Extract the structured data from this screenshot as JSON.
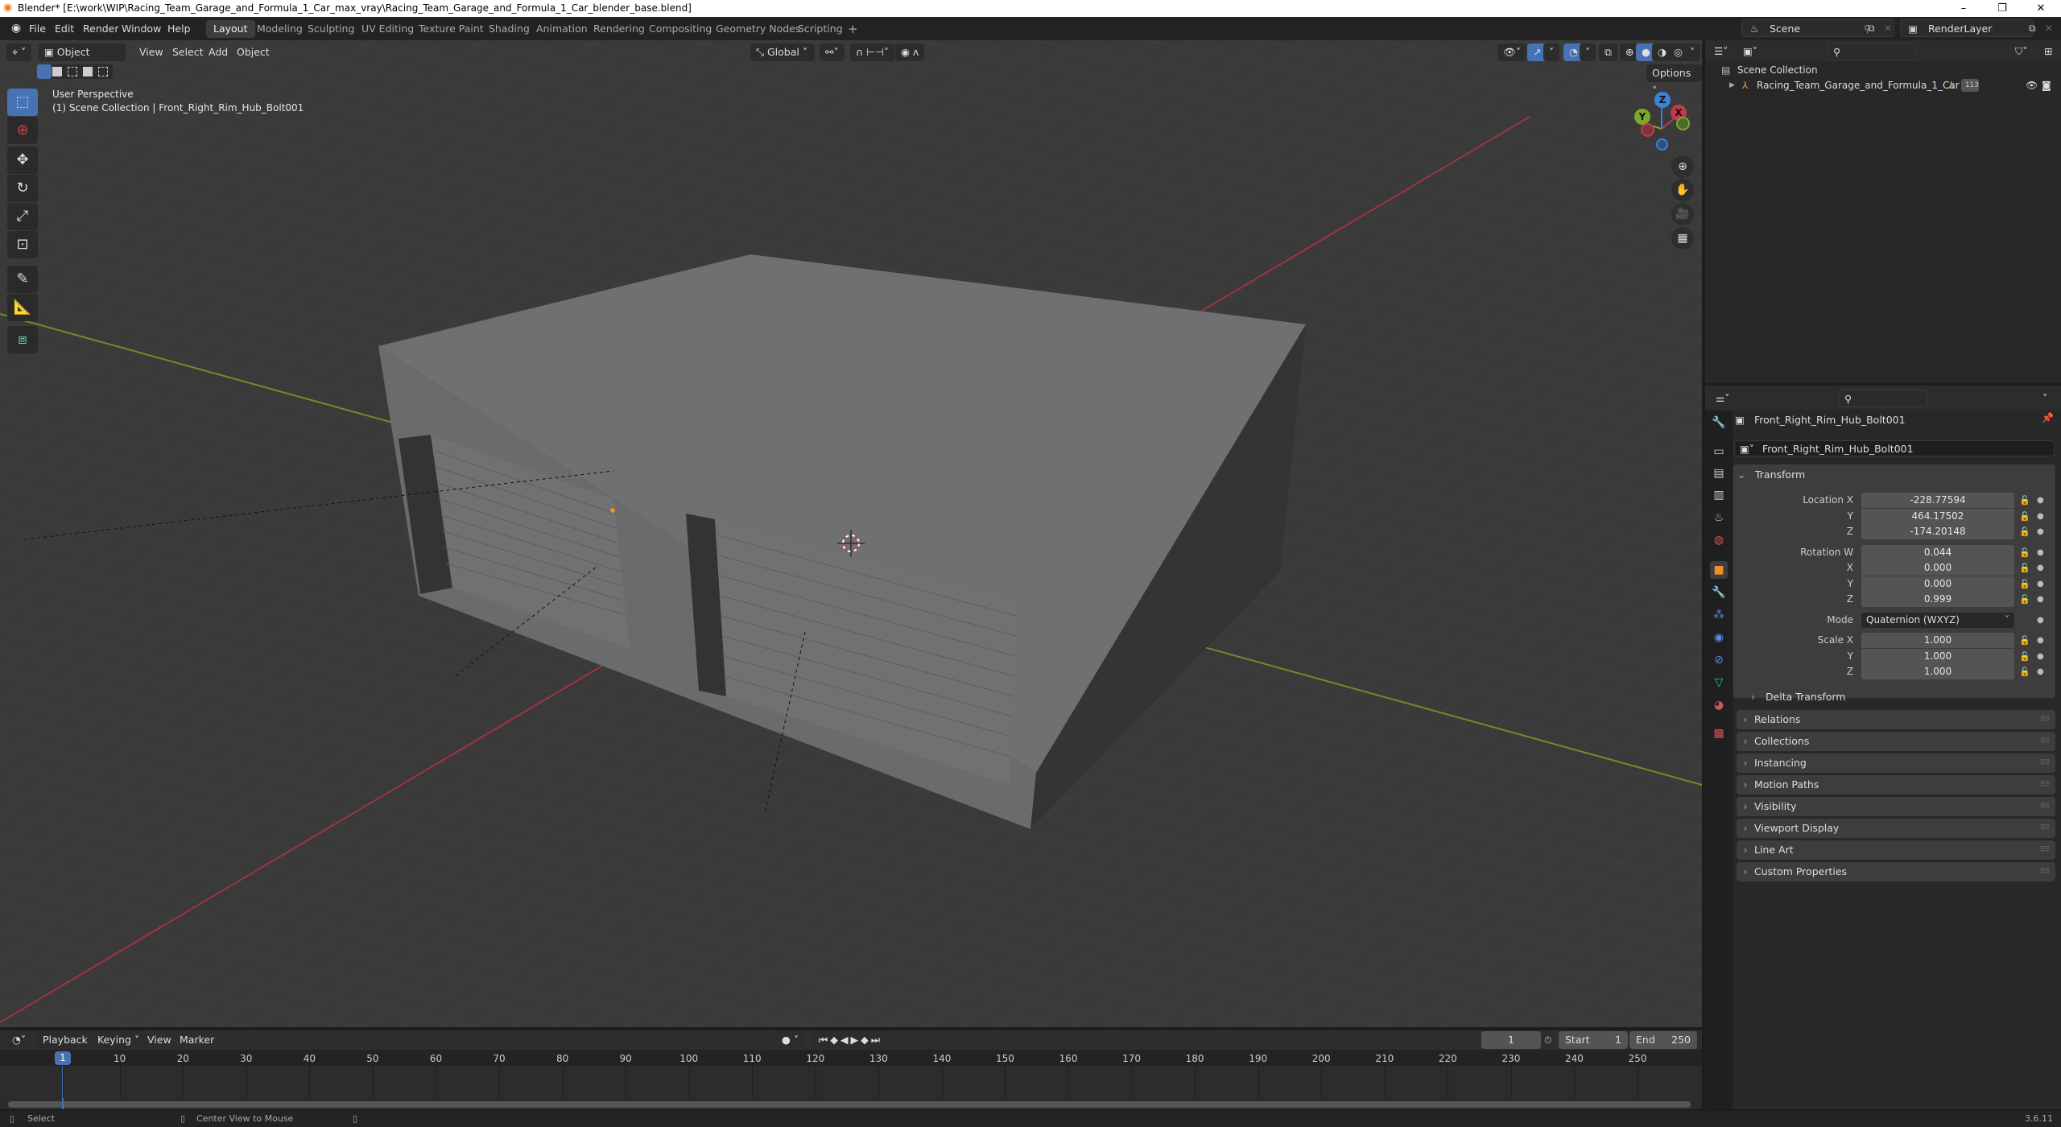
{
  "window": {
    "title": "Blender* [E:\\work\\WIP\\Racing_Team_Garage_and_Formula_1_Car_max_vray\\Racing_Team_Garage_and_Formula_1_Car_blender_base.blend]",
    "controls": {
      "minimize": "–",
      "restore": "❐",
      "close": "✕"
    }
  },
  "menubar": {
    "items": [
      "File",
      "Edit",
      "Render",
      "Window",
      "Help"
    ],
    "workspaces": [
      "Layout",
      "Modeling",
      "Sculpting",
      "UV Editing",
      "Texture Paint",
      "Shading",
      "Animation",
      "Rendering",
      "Compositing",
      "Geometry Nodes",
      "Scripting"
    ],
    "active_workspace": "Layout",
    "add_workspace": "+",
    "scene": "Scene",
    "view_layer": "RenderLayer"
  },
  "viewport": {
    "mode": "Object Mode",
    "menus": [
      "View",
      "Select",
      "Add",
      "Object"
    ],
    "transform_orientation": "Global",
    "options_label": "Options",
    "overlay_title": "User Perspective",
    "overlay_subtitle": "(1) Scene Collection | Front_Right_Rim_Hub_Bolt001",
    "gizmo_axes": {
      "x": "X",
      "y": "Y",
      "z": "Z"
    },
    "shading_mode": "solid",
    "tools": [
      "select-box",
      "cursor",
      "move",
      "rotate",
      "scale",
      "transform",
      "annotate",
      "measure",
      "add-cube"
    ],
    "active_tool": "select-box",
    "colors": {
      "x_axis": "#c33a4c",
      "y_axis": "#7aaa2b",
      "z_axis": "#3d82d9",
      "accent": "#4772b3"
    }
  },
  "outliner": {
    "root": "Scene Collection",
    "items": [
      {
        "name": "Racing_Team_Garage_and_Formula_1_Car",
        "badge": "113"
      }
    ]
  },
  "properties": {
    "object_name": "Front_Right_Rim_Hub_Bolt001",
    "datablock_name": "Front_Right_Rim_Hub_Bolt001",
    "transform_label": "Transform",
    "location": {
      "label": "Location X",
      "x": "-228.77594",
      "y": "464.17502",
      "z": "-174.20148"
    },
    "rotation": {
      "label": "Rotation W",
      "w": "0.044",
      "x": "0.000",
      "y": "0.000",
      "z": "0.999"
    },
    "mode": {
      "label": "Mode",
      "value": "Quaternion (WXYZ)"
    },
    "scale": {
      "label": "Scale X",
      "x": "1.000",
      "y": "1.000",
      "z": "1.000"
    },
    "axis_labels": {
      "x": "X",
      "y": "Y",
      "z": "Z"
    },
    "delta_transform": "Delta Transform",
    "panels": [
      "Relations",
      "Collections",
      "Instancing",
      "Motion Paths",
      "Visibility",
      "Viewport Display",
      "Line Art",
      "Custom Properties"
    ]
  },
  "timeline": {
    "menus": [
      "Playback",
      "Keying",
      "View",
      "Marker"
    ],
    "current_frame": "1",
    "start_label": "Start",
    "start": "1",
    "end_label": "End",
    "end": "250",
    "ticks": [
      "1",
      "10",
      "20",
      "30",
      "40",
      "50",
      "60",
      "70",
      "80",
      "90",
      "100",
      "110",
      "120",
      "130",
      "140",
      "150",
      "160",
      "170",
      "180",
      "190",
      "200",
      "210",
      "220",
      "230",
      "240",
      "250"
    ]
  },
  "statusbar": {
    "left_hint": "Select",
    "middle_hint": "Center View to Mouse",
    "version": "3.6.11"
  }
}
